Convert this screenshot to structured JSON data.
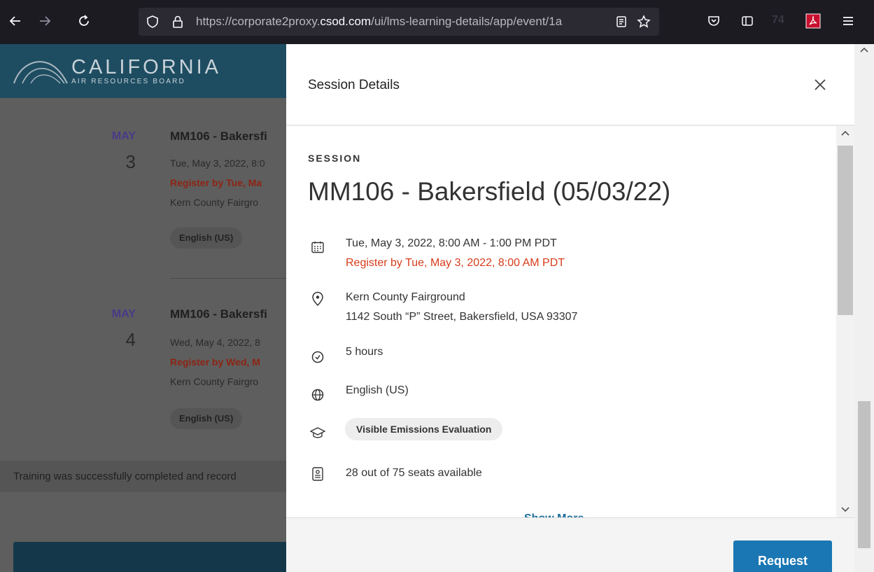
{
  "browser": {
    "url_prefix": "https://corporate2proxy.",
    "url_domain": "csod.com",
    "url_path": "/ui/lms-learning-details/app/event/1a",
    "counter": "74",
    "icons": [
      "back-icon",
      "forward-icon",
      "reload-icon",
      "shield-icon",
      "lock-icon",
      "reader-icon",
      "star-icon",
      "pocket-icon",
      "sidebar-icon",
      "pdf-icon",
      "menu-icon"
    ]
  },
  "background": {
    "logo_main": "CALIFORNIA",
    "logo_sub": "AIR RESOURCES BOARD",
    "events": [
      {
        "month": "MAY",
        "day": "3",
        "title": "MM106 - Bakersfi",
        "datetime": "Tue, May 3, 2022, 8:0",
        "register": "Register by Tue, Ma",
        "location": "Kern County Fairgro",
        "language": "English (US)"
      },
      {
        "month": "MAY",
        "day": "4",
        "title": "MM106 - Bakersfi",
        "datetime": "Wed, May 4, 2022, 8",
        "register": "Register by Wed, M",
        "location": "Kern County Fairgro",
        "language": "English (US)"
      }
    ],
    "note": "Training was successfully completed and record"
  },
  "modal": {
    "title": "Session Details",
    "session_label": "SESSION",
    "session_title": "MM106 - Bakersfield (05/03/22)",
    "datetime": "Tue, May 3, 2022, 8:00 AM - 1:00 PM PDT",
    "register_by": "Register by Tue, May 3, 2022, 8:00 AM PDT",
    "location_name": "Kern County Fairground",
    "location_address": "1142 South “P” Street, Bakersfield, USA 93307",
    "duration": "5 hours",
    "language": "English (US)",
    "subject": "Visible Emissions Evaluation",
    "seats": "28 out of 75 seats available",
    "show_more": "Show More",
    "request_label": "Request"
  },
  "colors": {
    "register_red": "#d63d1b",
    "request_blue": "#1a77b3",
    "banner": "#1e4d62",
    "toolbar": "#1c1b22"
  }
}
